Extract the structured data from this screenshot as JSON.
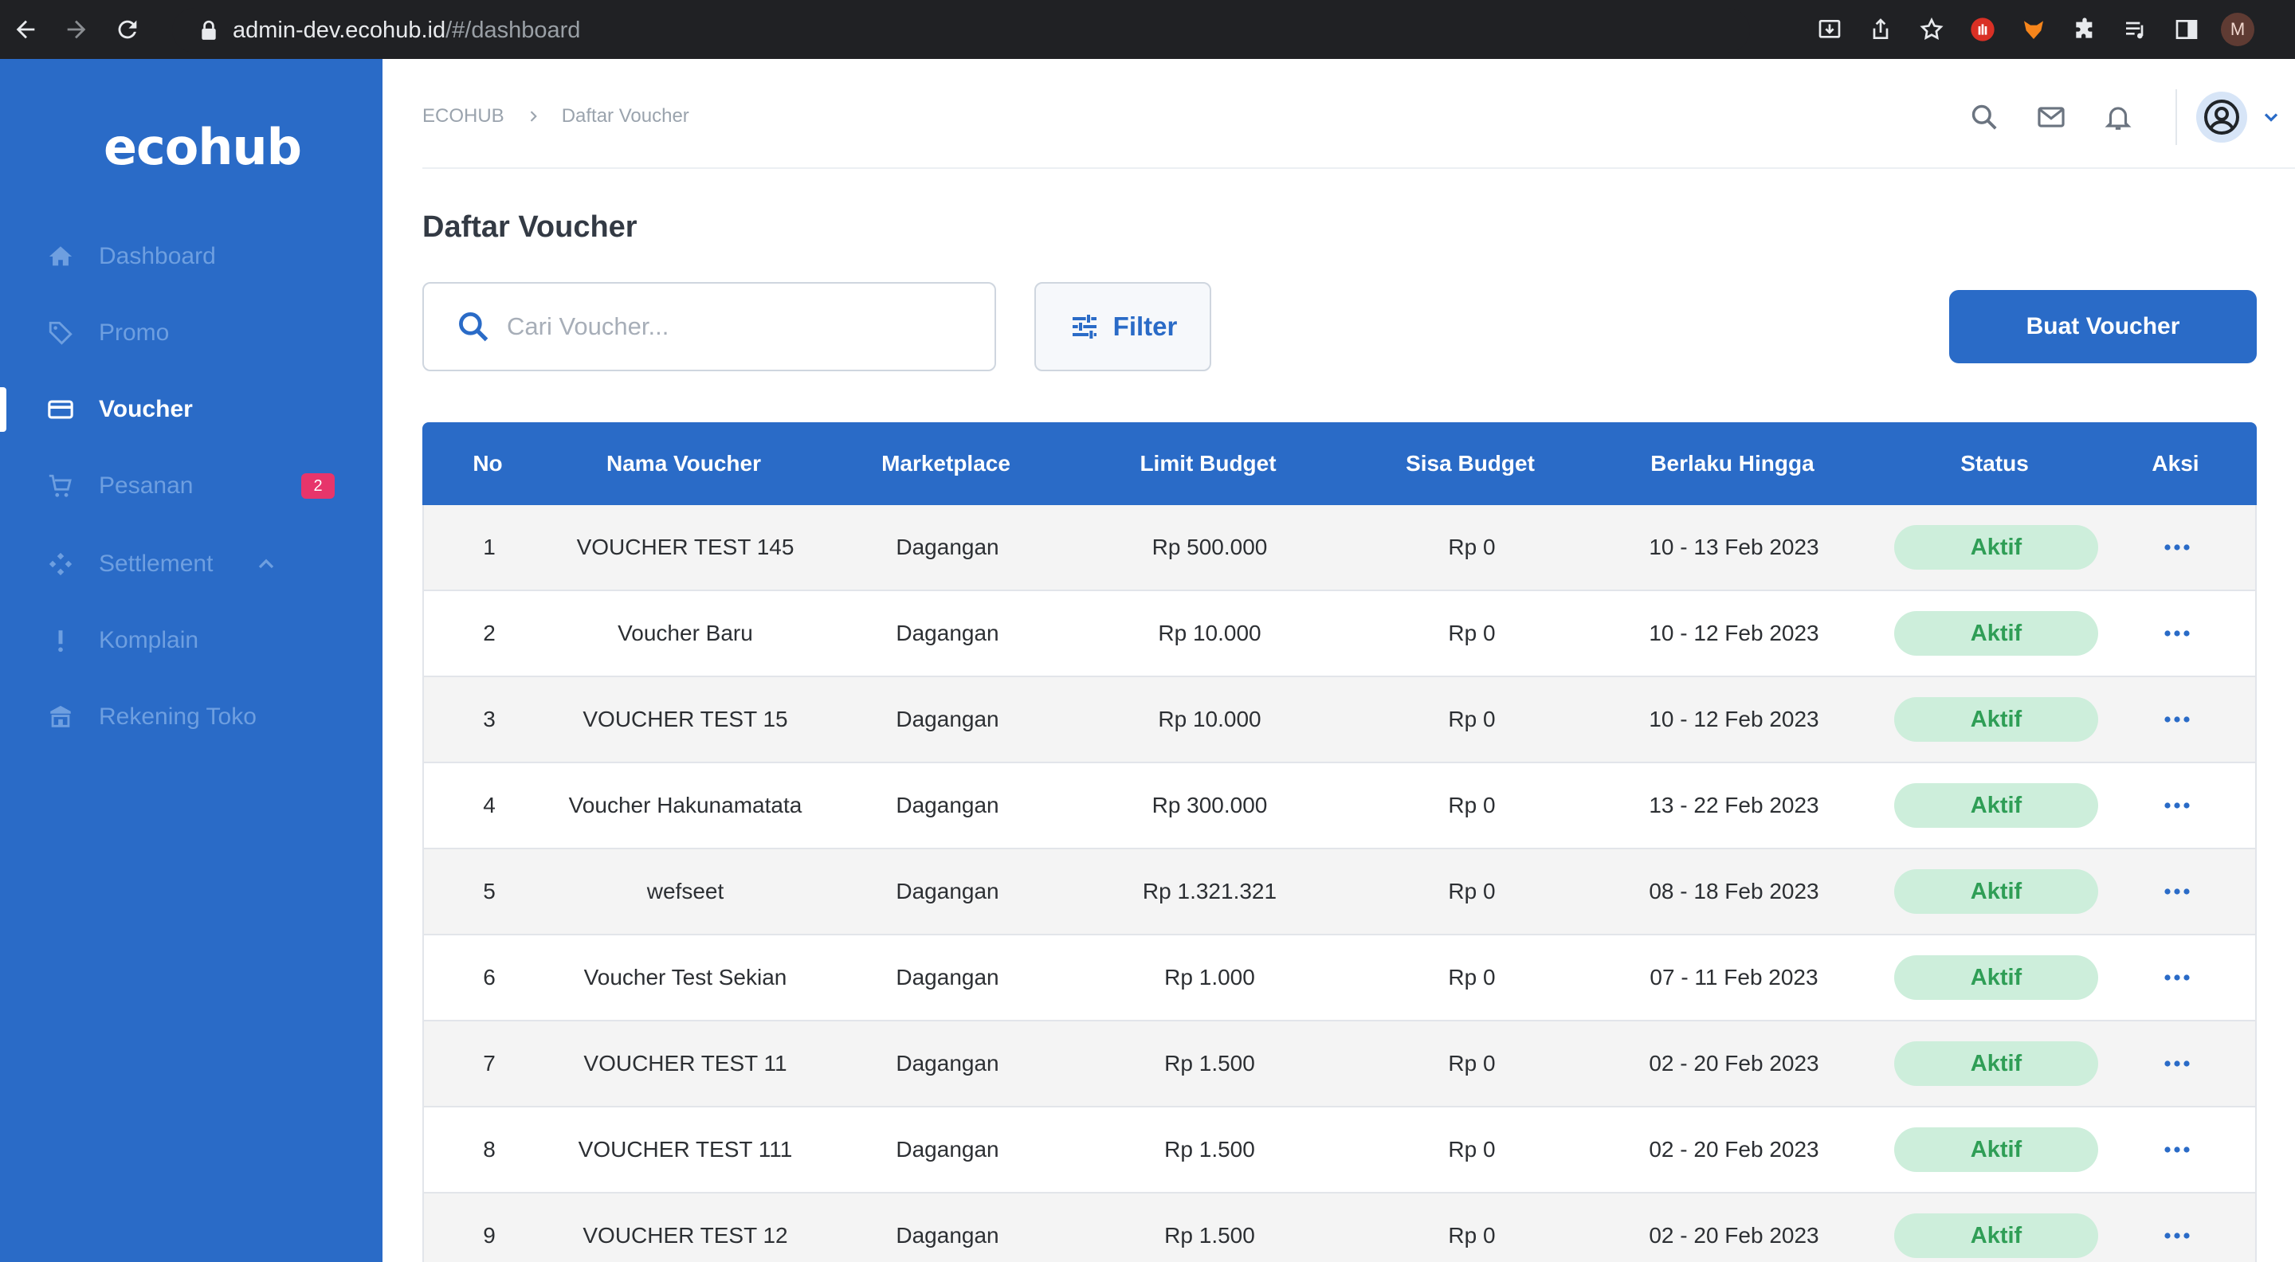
{
  "browser": {
    "url_host": "admin-dev.ecohub.id",
    "url_path": "/#/dashboard",
    "profile_initial": "M"
  },
  "sidebar": {
    "logo": "ecohub",
    "items": [
      {
        "label": "Dashboard",
        "icon": "home-icon",
        "active": false
      },
      {
        "label": "Promo",
        "icon": "tag-icon",
        "active": false
      },
      {
        "label": "Voucher",
        "icon": "card-icon",
        "active": true
      },
      {
        "label": "Pesanan",
        "icon": "cart-icon",
        "active": false,
        "badge": "2"
      },
      {
        "label": "Settlement",
        "icon": "settlement-icon",
        "active": false,
        "expanded": true
      },
      {
        "label": "Komplain",
        "icon": "exclamation-icon",
        "active": false
      },
      {
        "label": "Rekening Toko",
        "icon": "bank-icon",
        "active": false
      }
    ]
  },
  "header": {
    "breadcrumb": [
      "ECOHUB",
      "Daftar Voucher"
    ]
  },
  "page": {
    "title": "Daftar Voucher",
    "search_placeholder": "Cari Voucher...",
    "filter_label": "Filter",
    "create_label": "Buat Voucher"
  },
  "table": {
    "columns": [
      "No",
      "Nama Voucher",
      "Marketplace",
      "Limit Budget",
      "Sisa Budget",
      "Berlaku Hingga",
      "Status",
      "Aksi"
    ],
    "rows": [
      {
        "no": "1",
        "name": "VOUCHER TEST 145",
        "marketplace": "Dagangan",
        "limit": "Rp 500.000",
        "sisa": "Rp 0",
        "until": "10 - 13 Feb 2023",
        "status": "Aktif"
      },
      {
        "no": "2",
        "name": "Voucher Baru",
        "marketplace": "Dagangan",
        "limit": "Rp 10.000",
        "sisa": "Rp 0",
        "until": "10 - 12 Feb 2023",
        "status": "Aktif"
      },
      {
        "no": "3",
        "name": "VOUCHER TEST 15",
        "marketplace": "Dagangan",
        "limit": "Rp 10.000",
        "sisa": "Rp 0",
        "until": "10 - 12 Feb 2023",
        "status": "Aktif"
      },
      {
        "no": "4",
        "name": "Voucher Hakunamatata",
        "marketplace": "Dagangan",
        "limit": "Rp 300.000",
        "sisa": "Rp 0",
        "until": "13 - 22 Feb 2023",
        "status": "Aktif"
      },
      {
        "no": "5",
        "name": "wefseet",
        "marketplace": "Dagangan",
        "limit": "Rp 1.321.321",
        "sisa": "Rp 0",
        "until": "08 - 18 Feb 2023",
        "status": "Aktif"
      },
      {
        "no": "6",
        "name": "Voucher Test Sekian",
        "marketplace": "Dagangan",
        "limit": "Rp 1.000",
        "sisa": "Rp 0",
        "until": "07 - 11 Feb 2023",
        "status": "Aktif"
      },
      {
        "no": "7",
        "name": "VOUCHER TEST 11",
        "marketplace": "Dagangan",
        "limit": "Rp 1.500",
        "sisa": "Rp 0",
        "until": "02 - 20 Feb 2023",
        "status": "Aktif"
      },
      {
        "no": "8",
        "name": "VOUCHER TEST 111",
        "marketplace": "Dagangan",
        "limit": "Rp 1.500",
        "sisa": "Rp 0",
        "until": "02 - 20 Feb 2023",
        "status": "Aktif"
      },
      {
        "no": "9",
        "name": "VOUCHER TEST 12",
        "marketplace": "Dagangan",
        "limit": "Rp 1.500",
        "sisa": "Rp 0",
        "until": "02 - 20 Feb 2023",
        "status": "Aktif"
      }
    ]
  },
  "colors": {
    "primary": "#2a6bc7",
    "status_bg": "#cdeedb",
    "status_text": "#2f9e56",
    "badge": "#e7356b"
  }
}
